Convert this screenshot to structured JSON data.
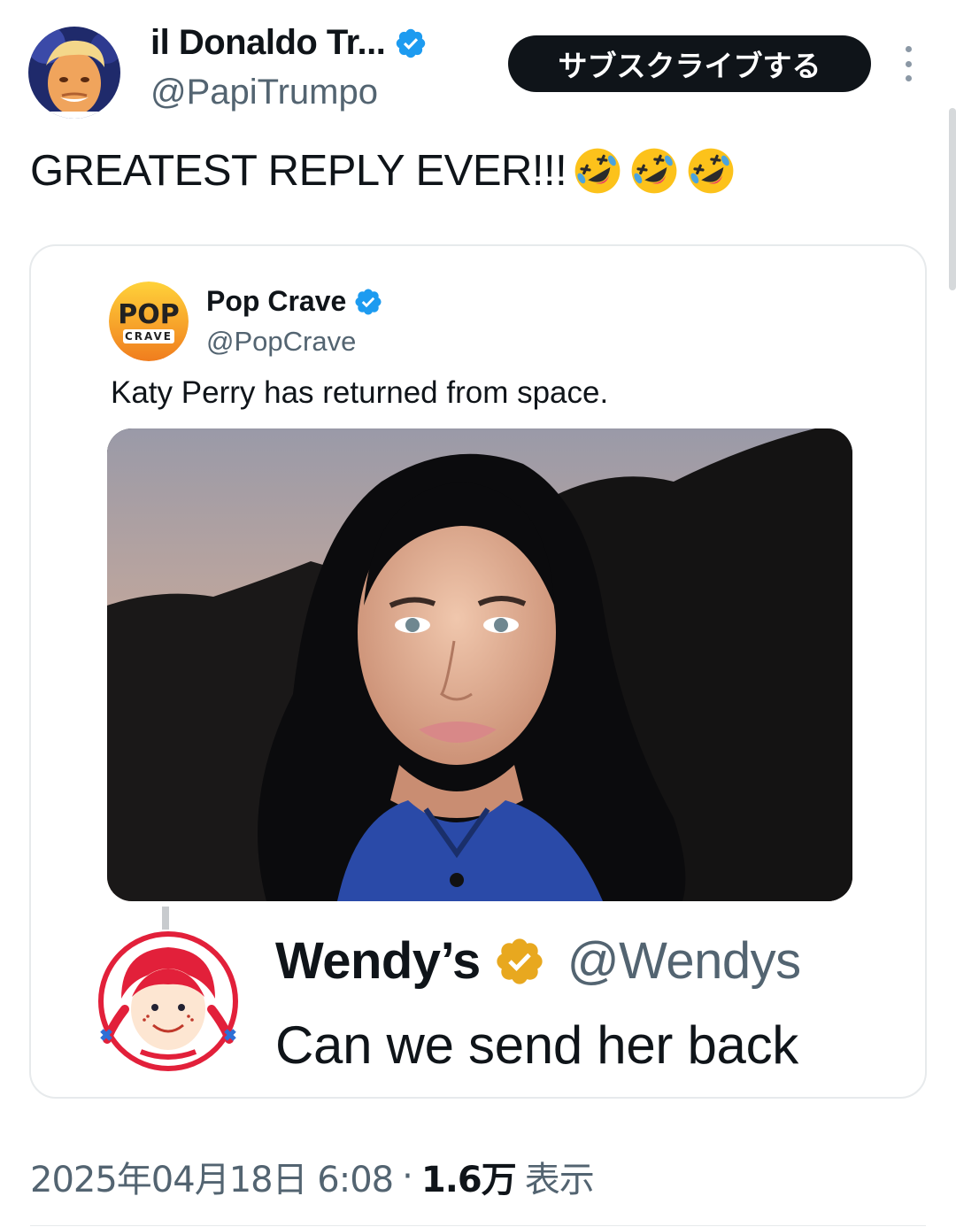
{
  "author": {
    "display_name": "il Donaldo Tr...",
    "handle": "@PapiTrumpo",
    "avatar": "avatar-photo",
    "verified_badge": "blue-check-icon"
  },
  "header": {
    "subscribe_label": "サブスクライブする",
    "more_icon": "more-vertical-icon"
  },
  "tweet": {
    "text": "GREATEST REPLY EVER!!!",
    "emojis": [
      "rolling-on-floor-laughing-icon",
      "rolling-on-floor-laughing-icon",
      "rolling-on-floor-laughing-icon"
    ]
  },
  "quote": {
    "logo_text_top": "POP",
    "logo_text_bottom": "CRAVE",
    "display_name": "Pop Crave",
    "handle": "@PopCrave",
    "text": "Katy Perry has returned from space.",
    "image": "portrait-photo"
  },
  "reply": {
    "display_name": "Wendy’s",
    "handle": "@Wendys",
    "text": "Can we send her back",
    "verified_badge": "gold-check-icon",
    "logo": "wendys-logo"
  },
  "meta": {
    "timestamp": "2025年04月18日 6:08",
    "separator": "·",
    "views_count": "1.6万",
    "views_label": "表示"
  },
  "colors": {
    "text_primary": "#0f1419",
    "text_secondary": "#536471",
    "verified_blue": "#1d9bf0",
    "verified_gold": "#e8a81f",
    "wendys_red": "#e2203a"
  }
}
